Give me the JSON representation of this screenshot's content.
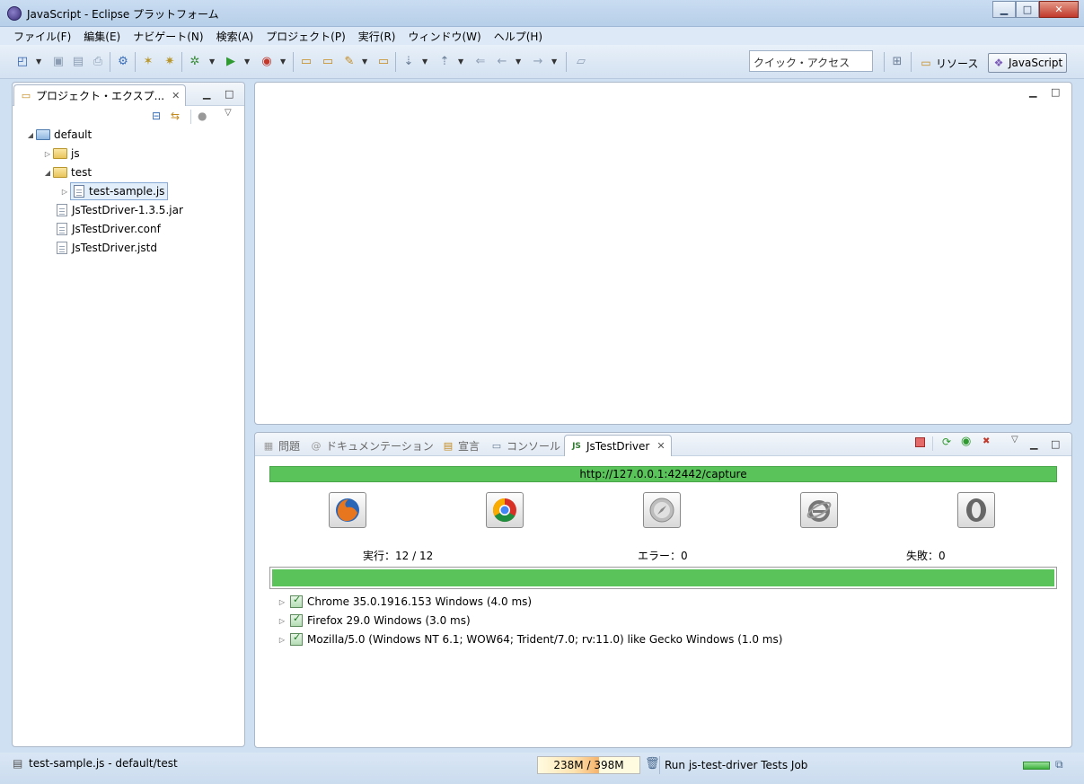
{
  "window": {
    "title": "JavaScript - Eclipse プラットフォーム",
    "controls": [
      "minimize",
      "maximize",
      "close"
    ]
  },
  "menu": [
    "ファイル(F)",
    "編集(E)",
    "ナビゲート(N)",
    "検索(A)",
    "プロジェクト(P)",
    "実行(R)",
    "ウィンドウ(W)",
    "ヘルプ(H)"
  ],
  "toolbar": {
    "quick_access": "クイック・アクセス",
    "perspectives": [
      {
        "label": "リソース",
        "active": false
      },
      {
        "label": "JavaScript",
        "active": true
      }
    ]
  },
  "explorer": {
    "tab_label": "プロジェクト・エクスプ...",
    "tree": [
      {
        "label": "default",
        "type": "folder",
        "expanded": true,
        "depth": 0
      },
      {
        "label": "js",
        "type": "folder",
        "expanded": false,
        "depth": 1
      },
      {
        "label": "test",
        "type": "folder",
        "expanded": true,
        "depth": 1
      },
      {
        "label": "test-sample.js",
        "type": "js-file",
        "expanded": false,
        "depth": 2,
        "selected": true
      },
      {
        "label": "JsTestDriver-1.3.5.jar",
        "type": "file",
        "depth": 1
      },
      {
        "label": "JsTestDriver.conf",
        "type": "file",
        "depth": 1
      },
      {
        "label": "JsTestDriver.jstd",
        "type": "file",
        "depth": 1
      }
    ]
  },
  "bottom_tabs": [
    {
      "label": "問題",
      "active": false
    },
    {
      "label": "ドキュメンテーション",
      "active": false
    },
    {
      "label": "宣言",
      "active": false
    },
    {
      "label": "コンソール",
      "active": false
    },
    {
      "label": "JsTestDriver",
      "active": true
    }
  ],
  "jstd": {
    "capture_url": "http://127.0.0.1:42442/capture",
    "browsers": [
      "firefox-icon",
      "chrome-icon",
      "safari-icon",
      "ie-icon",
      "opera-icon"
    ],
    "runs_label": "実行：12 / 12",
    "errors_label": "エラー：0",
    "failures_label": "失敗：0",
    "progress": 1.0,
    "results": [
      "Chrome 35.0.1916.153 Windows (4.0 ms)",
      "Firefox 29.0 Windows (3.0 ms)",
      "Mozilla/5.0 (Windows NT 6.1; WOW64; Trident/7.0; rv:11.0) like Gecko  Windows (1.0 ms)"
    ],
    "colors": {
      "success": "#5ac35a"
    }
  },
  "status": {
    "selection": "test-sample.js - default/test",
    "heap": "238M / 398M",
    "heap_used_fraction": 0.6,
    "job": "Run js-test-driver Tests Job"
  }
}
